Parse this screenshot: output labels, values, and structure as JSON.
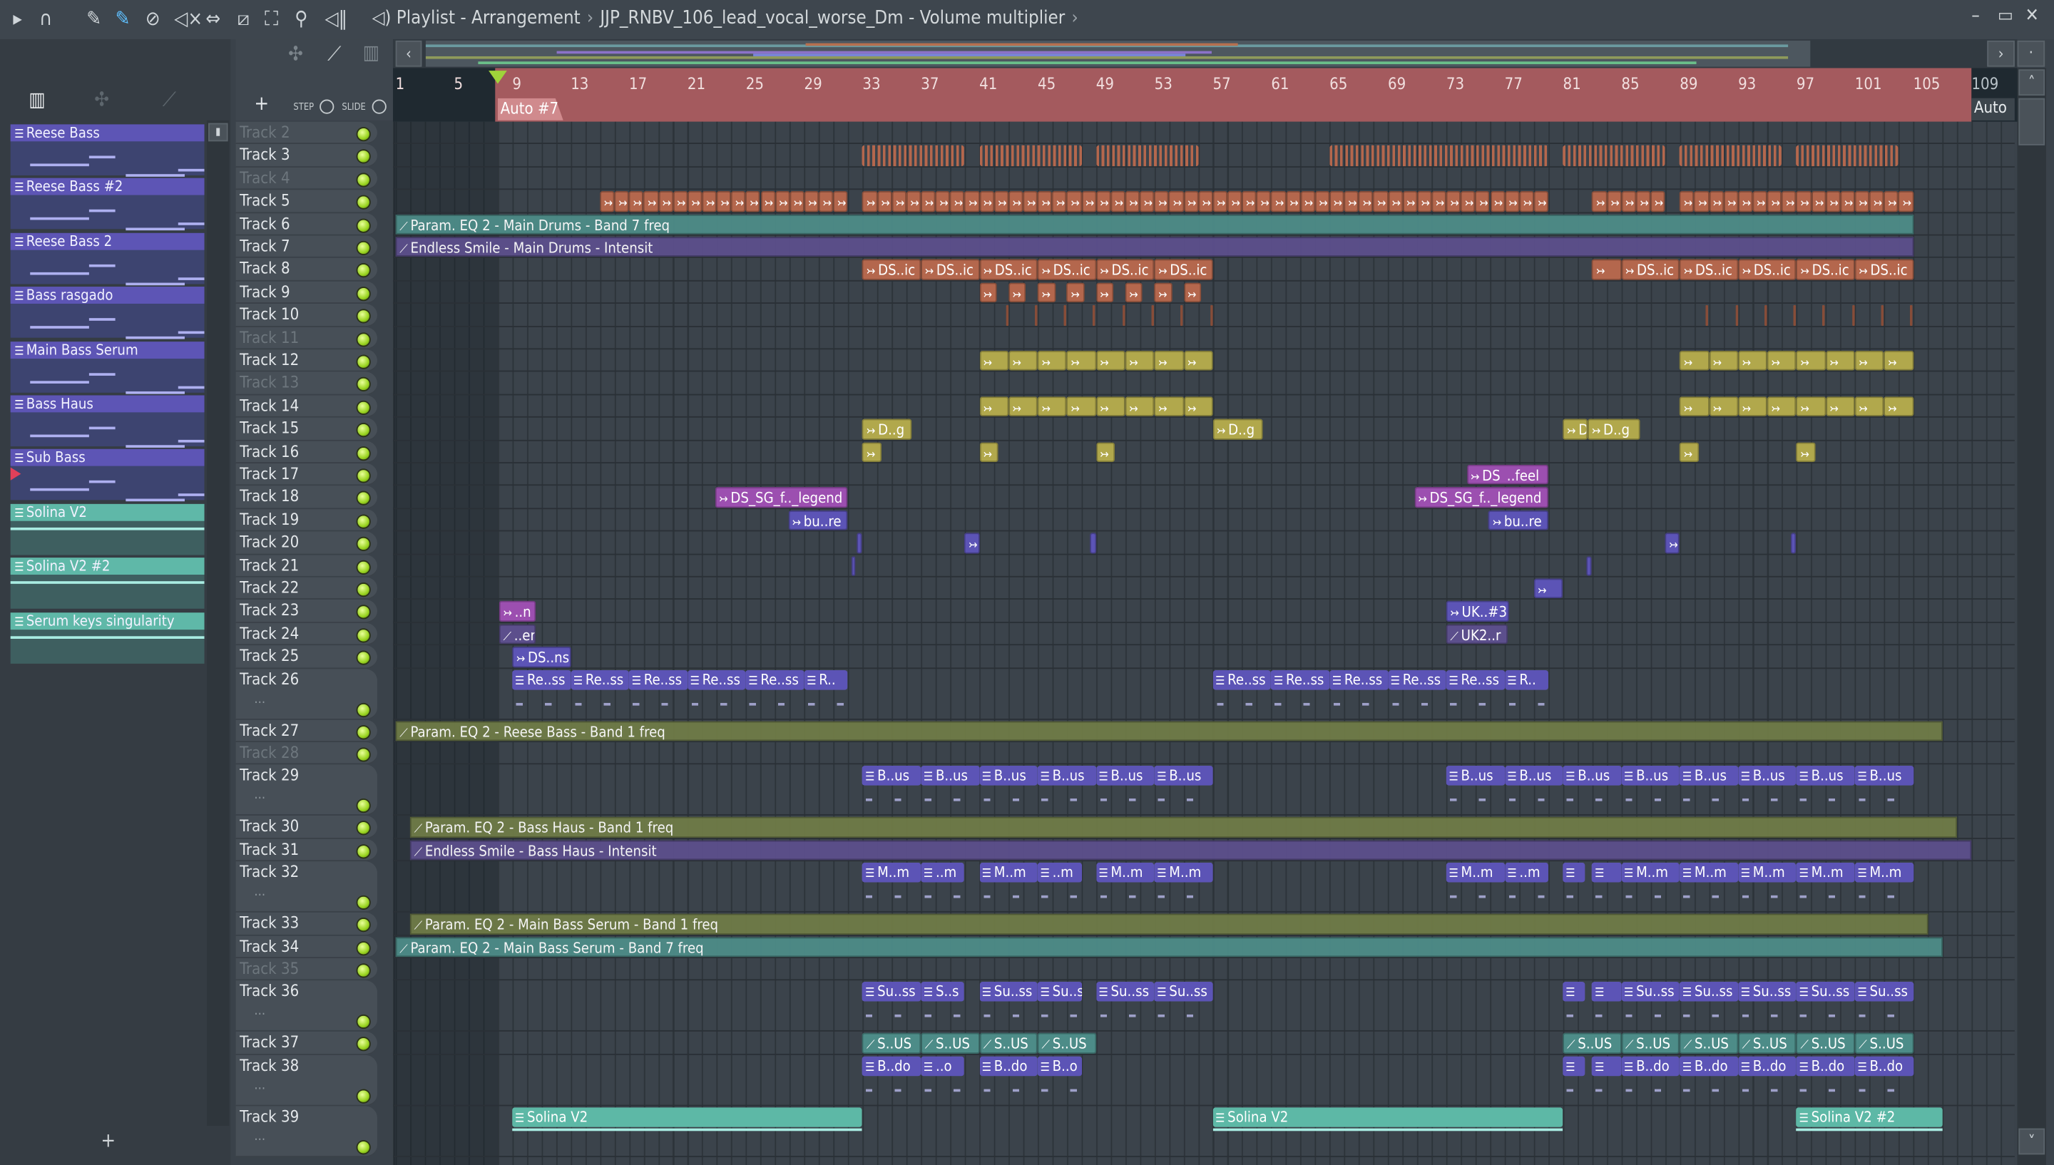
{
  "titlebar": {
    "section": "Playlist - Arrangement",
    "target": "JJP_RNBV_106_lead_vocal_worse_Dm - Volume multiplier"
  },
  "toolbar": {
    "step_label": "STEP",
    "slide_label": "SLIDE",
    "add_label": "+"
  },
  "ruler": {
    "bars": [
      1,
      5,
      9,
      13,
      17,
      21,
      25,
      29,
      33,
      37,
      41,
      45,
      49,
      53,
      57,
      61,
      65,
      69,
      73,
      77,
      81,
      85,
      89,
      93,
      97,
      101,
      105,
      109
    ],
    "auto_label": "Auto #7",
    "auto_right": "Auto"
  },
  "patterns": [
    {
      "name": "Reese Bass",
      "color": "purple"
    },
    {
      "name": "Reese Bass #2",
      "color": "purple"
    },
    {
      "name": "Reese Bass 2",
      "color": "purple"
    },
    {
      "name": "Bass rasgado",
      "color": "purple"
    },
    {
      "name": "Main Bass Serum",
      "color": "purple"
    },
    {
      "name": "Bass Haus",
      "color": "purple"
    },
    {
      "name": "Sub Bass",
      "color": "purple"
    },
    {
      "name": "Solina V2",
      "color": "teal"
    },
    {
      "name": "Solina V2 #2",
      "color": "teal"
    },
    {
      "name": "Serum keys singularity",
      "color": "teal"
    }
  ],
  "add_pattern": "+",
  "colors": {
    "orange": "#b4674d",
    "yellow": "#b1a84c",
    "purple": "#5c54b6",
    "magenta": "#9c4fb0",
    "teal": "#4d8c88",
    "violet": "#5c4f8c",
    "olive": "#6f7b47",
    "tealpat": "#5db8a6"
  },
  "tracks": [
    {
      "name": "Track 2",
      "dim": true
    },
    {
      "name": "Track 3"
    },
    {
      "name": "Track 4",
      "dim": true
    },
    {
      "name": "Track 5"
    },
    {
      "name": "Track 6"
    },
    {
      "name": "Track 7"
    },
    {
      "name": "Track 8"
    },
    {
      "name": "Track 9"
    },
    {
      "name": "Track 10"
    },
    {
      "name": "Track 11",
      "dim": true
    },
    {
      "name": "Track 12"
    },
    {
      "name": "Track 13",
      "dim": true
    },
    {
      "name": "Track 14"
    },
    {
      "name": "Track 15"
    },
    {
      "name": "Track 16"
    },
    {
      "name": "Track 17"
    },
    {
      "name": "Track 18"
    },
    {
      "name": "Track 19"
    },
    {
      "name": "Track 20"
    },
    {
      "name": "Track 21"
    },
    {
      "name": "Track 22"
    },
    {
      "name": "Track 23"
    },
    {
      "name": "Track 24"
    },
    {
      "name": "Track 25"
    },
    {
      "name": "Track 26",
      "tall": true
    },
    {
      "name": "Track 27"
    },
    {
      "name": "Track 28",
      "dim": true
    },
    {
      "name": "Track 29",
      "tall": true
    },
    {
      "name": "Track 30"
    },
    {
      "name": "Track 31"
    },
    {
      "name": "Track 32",
      "tall": true
    },
    {
      "name": "Track 33"
    },
    {
      "name": "Track 34"
    },
    {
      "name": "Track 35",
      "dim": true
    },
    {
      "name": "Track 36",
      "tall": true
    },
    {
      "name": "Track 37"
    },
    {
      "name": "Track 38",
      "tall": true
    },
    {
      "name": "Track 39",
      "tall": true
    }
  ],
  "clips": [
    {
      "t": 3,
      "b": [
        33,
        40
      ],
      "kind": "stripes",
      "color": "orange"
    },
    {
      "t": 3,
      "b": [
        41,
        48
      ],
      "kind": "stripes",
      "color": "orange"
    },
    {
      "t": 3,
      "b": [
        49,
        56
      ],
      "kind": "stripes",
      "color": "orange"
    },
    {
      "t": 3,
      "b": [
        65,
        80
      ],
      "kind": "stripes",
      "color": "orange"
    },
    {
      "t": 3,
      "b": [
        81,
        88
      ],
      "kind": "stripes",
      "color": "orange"
    },
    {
      "t": 3,
      "b": [
        89,
        96
      ],
      "kind": "stripes",
      "color": "orange"
    },
    {
      "t": 3,
      "b": [
        97,
        104
      ],
      "kind": "stripes",
      "color": "orange"
    },
    {
      "t": 5,
      "b": [
        15,
        32
      ],
      "rep": 17,
      "kind": "audio",
      "color": "orange"
    },
    {
      "t": 5,
      "b": [
        33,
        80
      ],
      "rep": 47,
      "kind": "audio",
      "color": "orange"
    },
    {
      "t": 5,
      "b": [
        83,
        88
      ],
      "rep": 5,
      "kind": "audio",
      "color": "orange"
    },
    {
      "t": 5,
      "b": [
        89,
        105
      ],
      "rep": 16,
      "kind": "audio",
      "color": "orange"
    },
    {
      "t": 6,
      "b": [
        1,
        105
      ],
      "kind": "auto",
      "color": "teal",
      "label": "Param. EQ 2 - Main Drums - Band 7 freq"
    },
    {
      "t": 7,
      "b": [
        1,
        105
      ],
      "kind": "auto",
      "color": "violet",
      "label": "Endless Smile - Main Drums - Intensit"
    },
    {
      "t": 8,
      "b": [
        33,
        37,
        41,
        45,
        49,
        53,
        57
      ],
      "kind": "audio",
      "color": "orange",
      "labels": [
        "DS..ic",
        "DS..ic",
        "DS..ic",
        "DS..ic",
        "DS..ic",
        "DS..ic"
      ]
    },
    {
      "t": 8,
      "b": [
        83,
        85,
        89,
        93,
        97,
        101,
        105
      ],
      "kind": "audio",
      "color": "orange",
      "labels": [
        "",
        "DS..ic",
        "DS..ic",
        "DS..ic",
        "DS..ic",
        "DS..ic"
      ]
    },
    {
      "t": 9,
      "at": [
        41,
        43,
        45,
        47,
        49,
        51,
        53,
        55
      ],
      "len": 1.2,
      "kind": "audio",
      "color": "orange"
    },
    {
      "t": 10,
      "at": [
        42.8,
        44.8,
        46.8,
        48.8,
        50.8,
        52.8,
        54.8,
        56.8,
        90.8,
        92.8,
        94.8,
        96.8,
        98.8,
        100.8,
        102.8,
        104.8
      ],
      "len": 0.18,
      "kind": "tick",
      "color": "orange"
    },
    {
      "t": 12,
      "b": [
        41,
        43,
        45,
        47,
        49,
        51,
        53,
        55,
        57
      ],
      "kind": "audio",
      "color": "yellow"
    },
    {
      "t": 12,
      "b": [
        89,
        91,
        93,
        95,
        97,
        99,
        101,
        103,
        105
      ],
      "kind": "audio",
      "color": "yellow"
    },
    {
      "t": 14,
      "b": [
        41,
        43,
        45,
        47,
        49,
        51,
        53,
        55,
        57
      ],
      "kind": "audio",
      "color": "yellow"
    },
    {
      "t": 14,
      "b": [
        89,
        91,
        93,
        95,
        97,
        99,
        101,
        103,
        105
      ],
      "kind": "audio",
      "color": "yellow"
    },
    {
      "t": 15,
      "b": [
        33,
        36.4
      ],
      "kind": "audio",
      "color": "yellow",
      "labels": [
        "D..g"
      ]
    },
    {
      "t": 15,
      "b": [
        57,
        60.4
      ],
      "kind": "audio",
      "color": "yellow",
      "labels": [
        "D..g"
      ]
    },
    {
      "t": 15,
      "b": [
        81,
        82.7,
        86.3
      ],
      "kind": "audio",
      "color": "yellow",
      "labels": [
        "D",
        "D..g"
      ]
    },
    {
      "t": 16,
      "at": [
        33,
        41,
        49,
        89,
        97
      ],
      "len": 1.3,
      "kind": "audio",
      "color": "yellow"
    },
    {
      "t": 17,
      "b": [
        74.4,
        80
      ],
      "kind": "audio",
      "color": "magenta",
      "labels": [
        "DS_..feel"
      ]
    },
    {
      "t": 18,
      "b": [
        22.9,
        32
      ],
      "kind": "audio",
      "color": "magenta",
      "labels": [
        "DS_SG_f.._legend"
      ]
    },
    {
      "t": 18,
      "b": [
        70.8,
        80
      ],
      "kind": "audio",
      "color": "magenta",
      "labels": [
        "DS_SG_f.._legend"
      ]
    },
    {
      "t": 19,
      "b": [
        27.9,
        32
      ],
      "kind": "audio",
      "color": "purple",
      "labels": [
        "bu..re"
      ]
    },
    {
      "t": 19,
      "b": [
        75.9,
        80
      ],
      "kind": "audio",
      "color": "purple",
      "labels": [
        "bu..re"
      ]
    },
    {
      "t": 20,
      "at": [
        32.6,
        48.6,
        96.6
      ],
      "len": 0.4,
      "kind": "tick",
      "color": "purple"
    },
    {
      "t": 20,
      "at": [
        40,
        88
      ],
      "len": 1,
      "kind": "audio",
      "color": "purple"
    },
    {
      "t": 21,
      "at": [
        32.2,
        82.6
      ],
      "len": 0.35,
      "kind": "tick",
      "color": "purple"
    },
    {
      "t": 22,
      "at": [
        79
      ],
      "len": 2,
      "kind": "audio",
      "color": "purple"
    },
    {
      "t": 23,
      "b": [
        8.1,
        10.6
      ],
      "kind": "audio",
      "color": "magenta",
      "labels": [
        "..n"
      ]
    },
    {
      "t": 23,
      "b": [
        73,
        77.3
      ],
      "kind": "audio",
      "color": "purple",
      "labels": [
        "UK..#3"
      ]
    },
    {
      "t": 24,
      "b": [
        8.1,
        10.6
      ],
      "kind": "autoclip",
      "color": "violet",
      "labels": [
        "..er"
      ]
    },
    {
      "t": 24,
      "b": [
        73,
        77.2
      ],
      "kind": "autoclip",
      "color": "violet",
      "labels": [
        "UK2..r"
      ]
    },
    {
      "t": 25,
      "b": [
        9,
        13
      ],
      "kind": "audio",
      "color": "purple",
      "labels": [
        "DS..ns"
      ]
    },
    {
      "t": 26,
      "b": [
        9,
        13,
        17,
        21,
        25,
        29,
        32
      ],
      "kind": "pattern",
      "color": "purple",
      "labels": [
        "Re..ss",
        "Re..ss",
        "Re..ss",
        "Re..ss",
        "Re..ss",
        "R.."
      ]
    },
    {
      "t": 26,
      "b": [
        57,
        61,
        65,
        69,
        73,
        77,
        80
      ],
      "kind": "pattern",
      "color": "purple",
      "labels": [
        "Re..ss",
        "Re..ss",
        "Re..ss",
        "Re..ss",
        "Re..ss",
        "R.."
      ]
    },
    {
      "t": 27,
      "b": [
        1,
        107
      ],
      "kind": "auto",
      "color": "olive",
      "label": "Param. EQ 2 - Reese Bass - Band 1 freq"
    },
    {
      "t": 29,
      "b": [
        33,
        37,
        41,
        45,
        49,
        53,
        57
      ],
      "kind": "pattern",
      "color": "purple",
      "labels": [
        "B..us",
        "B..us",
        "B..us",
        "B..us",
        "B..us",
        "B..us"
      ]
    },
    {
      "t": 29,
      "b": [
        73,
        77,
        81,
        85,
        89,
        93,
        97,
        101,
        105
      ],
      "kind": "pattern",
      "color": "purple",
      "labels": [
        "B..us",
        "B..us",
        "B..us",
        "B..us",
        "B..us",
        "B..us",
        "B..us",
        "B..us"
      ]
    },
    {
      "t": 30,
      "b": [
        2,
        108
      ],
      "kind": "auto",
      "color": "olive",
      "label": "Param. EQ 2 - Bass Haus - Band 1 freq"
    },
    {
      "t": 31,
      "b": [
        2,
        109
      ],
      "kind": "auto",
      "color": "violet",
      "label": "Endless Smile - Bass Haus - Intensit"
    },
    {
      "t": 32,
      "b": [
        33,
        37,
        40
      ],
      "kind": "pattern",
      "color": "purple",
      "labels": [
        "M..m",
        "..m"
      ]
    },
    {
      "t": 32,
      "b": [
        41,
        45,
        48
      ],
      "kind": "pattern",
      "color": "purple",
      "labels": [
        "M..m",
        "..m"
      ]
    },
    {
      "t": 32,
      "b": [
        49,
        53,
        57
      ],
      "kind": "pattern",
      "color": "purple",
      "labels": [
        "M..m",
        "M..m"
      ]
    },
    {
      "t": 32,
      "b": [
        73,
        77,
        80
      ],
      "kind": "pattern",
      "color": "purple",
      "labels": [
        "M..m",
        "..m"
      ]
    },
    {
      "t": 32,
      "b": [
        81,
        82.5
      ],
      "kind": "pattern",
      "color": "purple",
      "labels": [
        ""
      ]
    },
    {
      "t": 32,
      "b": [
        83,
        85,
        89,
        93,
        97,
        101,
        105
      ],
      "kind": "pattern",
      "color": "purple",
      "labels": [
        "",
        "M..m",
        "M..m",
        "M..m",
        "M..m",
        "M..m"
      ]
    },
    {
      "t": 33,
      "b": [
        2,
        106
      ],
      "kind": "auto",
      "color": "olive",
      "label": "Param. EQ 2 - Main Bass Serum - Band 1 freq"
    },
    {
      "t": 34,
      "b": [
        1,
        107
      ],
      "kind": "auto",
      "color": "teal",
      "label": "Param. EQ 2 - Main Bass Serum - Band 7 freq"
    },
    {
      "t": 36,
      "b": [
        33,
        37,
        40
      ],
      "kind": "pattern",
      "color": "purple",
      "labels": [
        "Su..ss",
        "S..s"
      ]
    },
    {
      "t": 36,
      "b": [
        41,
        45,
        48
      ],
      "kind": "pattern",
      "color": "purple",
      "labels": [
        "Su..ss",
        "Su..s"
      ]
    },
    {
      "t": 36,
      "b": [
        49,
        53,
        57
      ],
      "kind": "pattern",
      "color": "purple",
      "labels": [
        "Su..ss",
        "Su..ss"
      ]
    },
    {
      "t": 36,
      "b": [
        81,
        82.5
      ],
      "kind": "pattern",
      "color": "purple",
      "labels": [
        ""
      ]
    },
    {
      "t": 36,
      "b": [
        83,
        85,
        89,
        93,
        97,
        101,
        105
      ],
      "kind": "pattern",
      "color": "purple",
      "labels": [
        "",
        "Su..ss",
        "Su..ss",
        "Su..ss",
        "Su..ss",
        "Su..ss"
      ]
    },
    {
      "t": 37,
      "b": [
        33,
        37,
        41,
        45,
        49
      ],
      "kind": "autoclip",
      "color": "teal",
      "labels": [
        "S..US",
        "S..US",
        "S..US",
        "S..US"
      ]
    },
    {
      "t": 37,
      "b": [
        81,
        85,
        89,
        93,
        97,
        101,
        105
      ],
      "kind": "autoclip",
      "color": "teal",
      "labels": [
        "S..US",
        "S..US",
        "S..US",
        "S..US",
        "S..US",
        "S..US"
      ]
    },
    {
      "t": 38,
      "b": [
        33,
        37,
        40
      ],
      "kind": "pattern",
      "color": "purple",
      "labels": [
        "B..do",
        "..o"
      ]
    },
    {
      "t": 38,
      "b": [
        41,
        45,
        48
      ],
      "kind": "pattern",
      "color": "purple",
      "labels": [
        "B..do",
        "B..o"
      ]
    },
    {
      "t": 38,
      "b": [
        81,
        82.5
      ],
      "kind": "pattern",
      "color": "purple",
      "labels": [
        ""
      ]
    },
    {
      "t": 38,
      "b": [
        83,
        85,
        89,
        93,
        97,
        101,
        105
      ],
      "kind": "pattern",
      "color": "purple",
      "labels": [
        "",
        "B..do",
        "B..do",
        "B..do",
        "B..do",
        "B..do"
      ]
    },
    {
      "t": 39,
      "b": [
        9,
        33
      ],
      "kind": "pattern",
      "color": "tealpat",
      "labels": [
        "Solina V2"
      ]
    },
    {
      "t": 39,
      "b": [
        57,
        81
      ],
      "kind": "pattern",
      "color": "tealpat",
      "labels": [
        "Solina V2"
      ]
    },
    {
      "t": 39,
      "b": [
        97,
        107
      ],
      "kind": "pattern",
      "color": "tealpat",
      "labels": [
        "Solina V2 #2"
      ]
    }
  ]
}
